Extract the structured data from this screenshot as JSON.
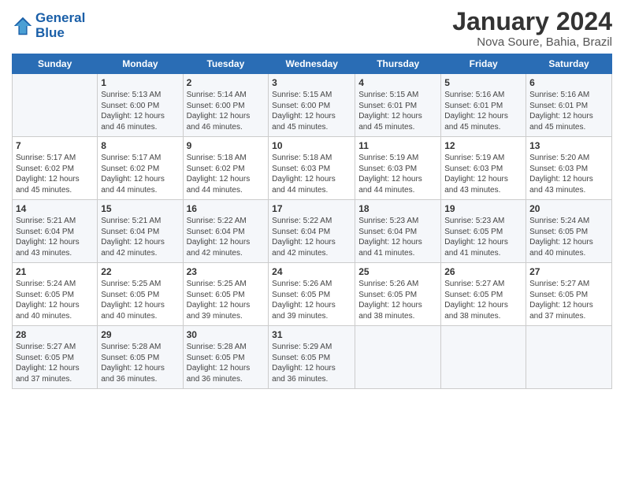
{
  "header": {
    "logo_line1": "General",
    "logo_line2": "Blue",
    "month_title": "January 2024",
    "location": "Nova Soure, Bahia, Brazil"
  },
  "days_of_week": [
    "Sunday",
    "Monday",
    "Tuesday",
    "Wednesday",
    "Thursday",
    "Friday",
    "Saturday"
  ],
  "weeks": [
    [
      {
        "day": "",
        "info": ""
      },
      {
        "day": "1",
        "info": "Sunrise: 5:13 AM\nSunset: 6:00 PM\nDaylight: 12 hours\nand 46 minutes."
      },
      {
        "day": "2",
        "info": "Sunrise: 5:14 AM\nSunset: 6:00 PM\nDaylight: 12 hours\nand 46 minutes."
      },
      {
        "day": "3",
        "info": "Sunrise: 5:15 AM\nSunset: 6:00 PM\nDaylight: 12 hours\nand 45 minutes."
      },
      {
        "day": "4",
        "info": "Sunrise: 5:15 AM\nSunset: 6:01 PM\nDaylight: 12 hours\nand 45 minutes."
      },
      {
        "day": "5",
        "info": "Sunrise: 5:16 AM\nSunset: 6:01 PM\nDaylight: 12 hours\nand 45 minutes."
      },
      {
        "day": "6",
        "info": "Sunrise: 5:16 AM\nSunset: 6:01 PM\nDaylight: 12 hours\nand 45 minutes."
      }
    ],
    [
      {
        "day": "7",
        "info": "Sunrise: 5:17 AM\nSunset: 6:02 PM\nDaylight: 12 hours\nand 45 minutes."
      },
      {
        "day": "8",
        "info": "Sunrise: 5:17 AM\nSunset: 6:02 PM\nDaylight: 12 hours\nand 44 minutes."
      },
      {
        "day": "9",
        "info": "Sunrise: 5:18 AM\nSunset: 6:02 PM\nDaylight: 12 hours\nand 44 minutes."
      },
      {
        "day": "10",
        "info": "Sunrise: 5:18 AM\nSunset: 6:03 PM\nDaylight: 12 hours\nand 44 minutes."
      },
      {
        "day": "11",
        "info": "Sunrise: 5:19 AM\nSunset: 6:03 PM\nDaylight: 12 hours\nand 44 minutes."
      },
      {
        "day": "12",
        "info": "Sunrise: 5:19 AM\nSunset: 6:03 PM\nDaylight: 12 hours\nand 43 minutes."
      },
      {
        "day": "13",
        "info": "Sunrise: 5:20 AM\nSunset: 6:03 PM\nDaylight: 12 hours\nand 43 minutes."
      }
    ],
    [
      {
        "day": "14",
        "info": "Sunrise: 5:21 AM\nSunset: 6:04 PM\nDaylight: 12 hours\nand 43 minutes."
      },
      {
        "day": "15",
        "info": "Sunrise: 5:21 AM\nSunset: 6:04 PM\nDaylight: 12 hours\nand 42 minutes."
      },
      {
        "day": "16",
        "info": "Sunrise: 5:22 AM\nSunset: 6:04 PM\nDaylight: 12 hours\nand 42 minutes."
      },
      {
        "day": "17",
        "info": "Sunrise: 5:22 AM\nSunset: 6:04 PM\nDaylight: 12 hours\nand 42 minutes."
      },
      {
        "day": "18",
        "info": "Sunrise: 5:23 AM\nSunset: 6:04 PM\nDaylight: 12 hours\nand 41 minutes."
      },
      {
        "day": "19",
        "info": "Sunrise: 5:23 AM\nSunset: 6:05 PM\nDaylight: 12 hours\nand 41 minutes."
      },
      {
        "day": "20",
        "info": "Sunrise: 5:24 AM\nSunset: 6:05 PM\nDaylight: 12 hours\nand 40 minutes."
      }
    ],
    [
      {
        "day": "21",
        "info": "Sunrise: 5:24 AM\nSunset: 6:05 PM\nDaylight: 12 hours\nand 40 minutes."
      },
      {
        "day": "22",
        "info": "Sunrise: 5:25 AM\nSunset: 6:05 PM\nDaylight: 12 hours\nand 40 minutes."
      },
      {
        "day": "23",
        "info": "Sunrise: 5:25 AM\nSunset: 6:05 PM\nDaylight: 12 hours\nand 39 minutes."
      },
      {
        "day": "24",
        "info": "Sunrise: 5:26 AM\nSunset: 6:05 PM\nDaylight: 12 hours\nand 39 minutes."
      },
      {
        "day": "25",
        "info": "Sunrise: 5:26 AM\nSunset: 6:05 PM\nDaylight: 12 hours\nand 38 minutes."
      },
      {
        "day": "26",
        "info": "Sunrise: 5:27 AM\nSunset: 6:05 PM\nDaylight: 12 hours\nand 38 minutes."
      },
      {
        "day": "27",
        "info": "Sunrise: 5:27 AM\nSunset: 6:05 PM\nDaylight: 12 hours\nand 37 minutes."
      }
    ],
    [
      {
        "day": "28",
        "info": "Sunrise: 5:27 AM\nSunset: 6:05 PM\nDaylight: 12 hours\nand 37 minutes."
      },
      {
        "day": "29",
        "info": "Sunrise: 5:28 AM\nSunset: 6:05 PM\nDaylight: 12 hours\nand 36 minutes."
      },
      {
        "day": "30",
        "info": "Sunrise: 5:28 AM\nSunset: 6:05 PM\nDaylight: 12 hours\nand 36 minutes."
      },
      {
        "day": "31",
        "info": "Sunrise: 5:29 AM\nSunset: 6:05 PM\nDaylight: 12 hours\nand 36 minutes."
      },
      {
        "day": "",
        "info": ""
      },
      {
        "day": "",
        "info": ""
      },
      {
        "day": "",
        "info": ""
      }
    ]
  ]
}
